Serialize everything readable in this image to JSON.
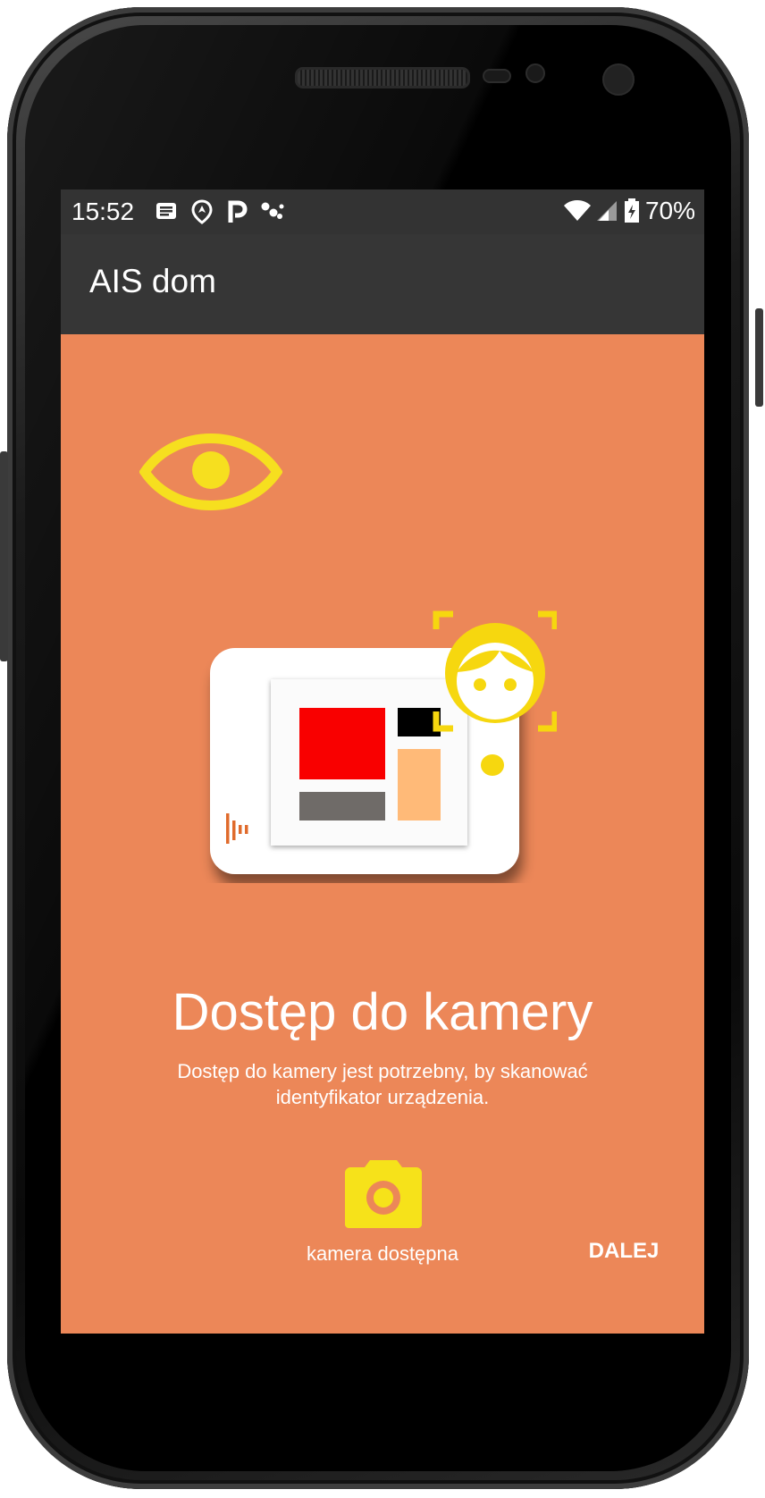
{
  "status_bar": {
    "time": "15:52",
    "notification_icons": [
      "news-icon",
      "location-icon",
      "parking-icon",
      "assistant-dots-icon"
    ],
    "battery_percent": "70%"
  },
  "app_bar": {
    "title": "AIS dom"
  },
  "main": {
    "headline": "Dostęp do kamery",
    "description": "Dostęp do kamery jest potrzebny, by skanować identyfikator urządzenia.",
    "camera_status_label": "kamera dostępna",
    "next_button": "DALEJ"
  },
  "colors": {
    "background": "#ec8758",
    "accent_yellow": "#f6df1f",
    "status_bar": "#333333",
    "app_bar": "#363636"
  }
}
